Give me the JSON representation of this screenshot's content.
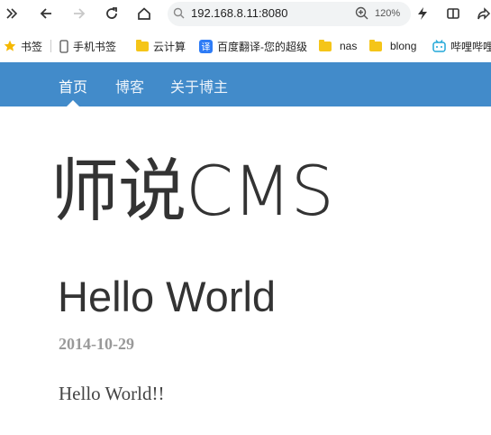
{
  "browser": {
    "url": "192.168.8.11:8080",
    "zoom": "120%"
  },
  "bookmarks": {
    "items": [
      {
        "label": "书签",
        "icon": "star-icon"
      },
      {
        "label": "手机书签",
        "icon": "phone-icon"
      },
      {
        "label": "云计算",
        "icon": "folder-icon"
      },
      {
        "label": "百度翻译-您的超级",
        "icon": "translate-icon"
      },
      {
        "label": "nas",
        "icon": "folder-icon"
      },
      {
        "label": "blong",
        "icon": "folder-icon"
      },
      {
        "label": "哔哩哔哩",
        "icon": "bilibili-icon"
      }
    ]
  },
  "navbar": {
    "items": [
      "首页",
      "博客",
      "关于博主"
    ],
    "color": "#428bca"
  },
  "site": {
    "title": "师说CMS"
  },
  "post": {
    "title": "Hello World",
    "date": "2014-10-29",
    "body": "Hello World!!"
  }
}
